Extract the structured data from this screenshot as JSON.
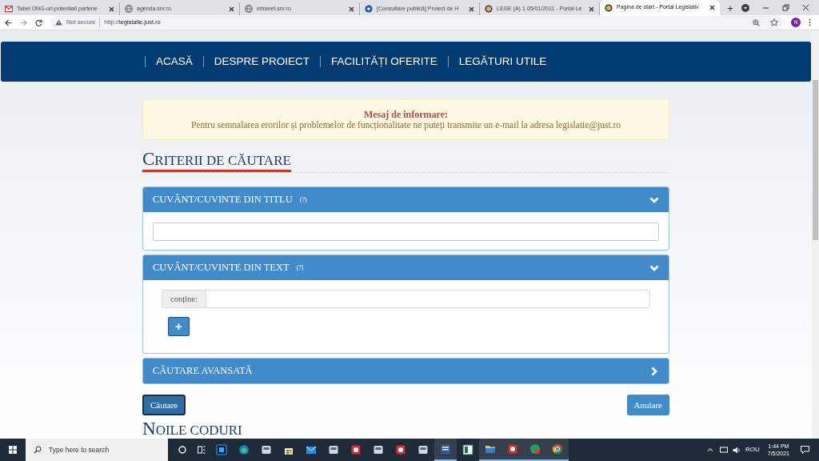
{
  "browser": {
    "tabs": [
      {
        "title": "Tabel ONG-uri-potentiali partene",
        "kind": "mail",
        "selected": false
      },
      {
        "title": "agenda.snr.ro",
        "kind": "web",
        "selected": false
      },
      {
        "title": "intranet.snr.ro",
        "kind": "web",
        "selected": false
      },
      {
        "title": "[Consultare publică] Proiect de H",
        "kind": "consultation",
        "selected": false
      },
      {
        "title": "LEGE (A) 1 05/01/2011 - Portal Le",
        "kind": "portal",
        "selected": false
      },
      {
        "title": "Pagina de start - Portal Legislativ",
        "kind": "portal",
        "selected": true
      }
    ],
    "new_tab": "+",
    "security": "Not secure",
    "url_prefix": "http://",
    "url_host": "legislatie.just.ro",
    "avatar": "N"
  },
  "nav": {
    "items": [
      "ACASĂ",
      "DESPRE PROIECT",
      "FACILITĂȚI OFERITE",
      "LEGĂTURI UTILE"
    ]
  },
  "notice": {
    "title": "Mesaj de informare:",
    "message": "Pentru semnalarea erorilor și problemelor de funcționalitate ne puteți transmite un e-mail la adresa legislatie@just.ro"
  },
  "search_heading": "CRITERII DE CĂUTARE",
  "panels": [
    {
      "title": "CUVÂNT/CUVINTE DIN TITLU",
      "help": "(?)",
      "expanded": true,
      "kind": "title"
    },
    {
      "title": "CUVÂNT/CUVINTE DIN TEXT",
      "help": "(?)",
      "expanded": true,
      "kind": "text",
      "field_label": "conține:",
      "add_button": "+"
    },
    {
      "title": "CĂUTARE AVANSATĂ",
      "expanded": false
    }
  ],
  "buttons": {
    "search": "Căutare",
    "cancel": "Anulare"
  },
  "next_heading": "NOILE CODURI",
  "taskbar": {
    "search_placeholder": "Type here to search",
    "apps": [
      {
        "kind": "photoshop",
        "running": false
      },
      {
        "kind": "edge",
        "running": false
      },
      {
        "kind": "app",
        "running": false
      },
      {
        "kind": "store",
        "running": false
      },
      {
        "kind": "mail",
        "running": false
      },
      {
        "kind": "app",
        "running": false
      },
      {
        "kind": "red",
        "running": false
      },
      {
        "kind": "app",
        "running": false
      },
      {
        "kind": "red",
        "running": false
      },
      {
        "kind": "app",
        "running": false
      },
      {
        "kind": "word",
        "running": true
      },
      {
        "kind": "excel",
        "running": false
      },
      {
        "kind": "folder",
        "running": true
      },
      {
        "kind": "red",
        "running": true
      },
      {
        "kind": "chat",
        "running": true
      },
      {
        "kind": "chrome",
        "running": true
      }
    ],
    "language": "ROU",
    "time": "1:44 PM",
    "date": "7/5/2021"
  }
}
